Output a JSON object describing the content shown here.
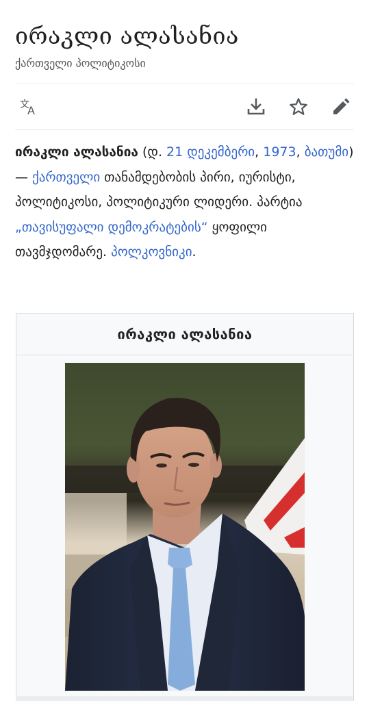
{
  "article": {
    "title": "ირაკლი ალასანია",
    "description": "ქართველი პოლიტიკოსი"
  },
  "toolbar": {
    "language_icon": "translate-icon",
    "download_icon": "download-icon",
    "watch_icon": "star-icon",
    "edit_icon": "pencil-icon"
  },
  "lead": {
    "name_bold": "ირაკლი ალასანია",
    "paren_open": " (დ. ",
    "birth_date_link": "21 დეკემბერი",
    "comma1": ", ",
    "birth_year_link": "1973",
    "comma2": ", ",
    "birth_place_link": "ბათუმი",
    "dash": ") — ",
    "nationality_link": "ქართველი",
    "text1": " თანამდებობის პირი, იურისტი, პოლიტიკოსი, პოლიტიკური ლიდერი. პარტია ",
    "party_link": "„თავისუფალი დემოკრატების“",
    "text2": " ყოფილი თავმჯდომარე. ",
    "rank_link": "პოლკოვნიკი",
    "text3": "."
  },
  "infobox": {
    "title": "ირაკლი ალასანია"
  },
  "colors": {
    "link": "#3366cc",
    "text": "#202122",
    "icon": "#54595d"
  }
}
